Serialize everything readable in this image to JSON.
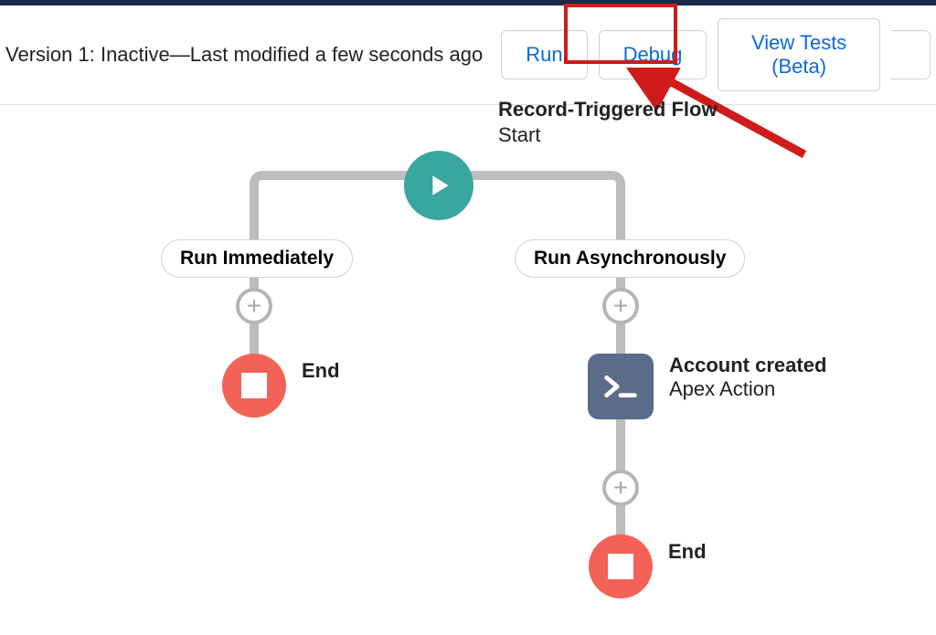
{
  "header": {
    "status": "Version 1: Inactive—Last modified a few seconds ago",
    "buttons": {
      "run": "Run",
      "debug": "Debug",
      "view_tests": "View Tests (Beta)"
    }
  },
  "flow": {
    "start_title": "Record-Triggered Flow",
    "start_sub": "Start",
    "branch_left": "Run Immediately",
    "branch_right": "Run Asynchronously",
    "end_label": "End",
    "action": {
      "title": "Account created",
      "subtitle": "Apex Action"
    }
  }
}
